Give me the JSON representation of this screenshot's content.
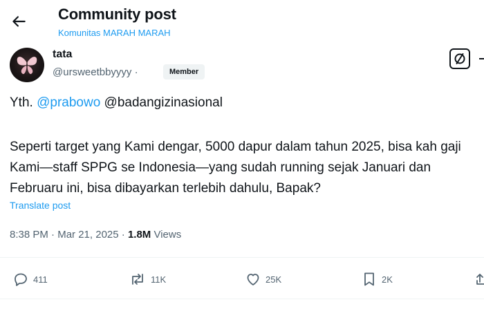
{
  "header": {
    "title": "Community post",
    "community": "Komunitas MARAH MARAH"
  },
  "author": {
    "name": "tata",
    "handle": "@ursweetbbyyyy",
    "separator": "·",
    "badge": "Member"
  },
  "post": {
    "greeting": "Yth.",
    "mention1": "@prabowo",
    "mention2": "@badangizinasional",
    "body": "Seperti target yang Kami dengar, 5000 dapur dalam tahun 2025, bisa kah gaji Kami—staff SPPG se Indonesia—yang sudah running sejak Januari dan Februaru ini, bisa dibayarkan terlebih dahulu, Bapak?",
    "translate": "Translate post"
  },
  "meta": {
    "time": "8:38 PM",
    "dot": "·",
    "date": "Mar 21, 2025",
    "views_count": "1.8M",
    "views_label": "Views"
  },
  "actions": {
    "replies": "411",
    "reposts": "11K",
    "likes": "25K",
    "bookmarks": "2K"
  },
  "colors": {
    "accent": "#1d9bf0",
    "text": "#0f1419",
    "muted": "#536471",
    "divider": "#eff3f4"
  },
  "icons": [
    "back-arrow-icon",
    "butterfly-avatar",
    "grok-icon",
    "reply-icon",
    "repost-icon",
    "like-icon",
    "bookmark-icon",
    "share-icon"
  ]
}
